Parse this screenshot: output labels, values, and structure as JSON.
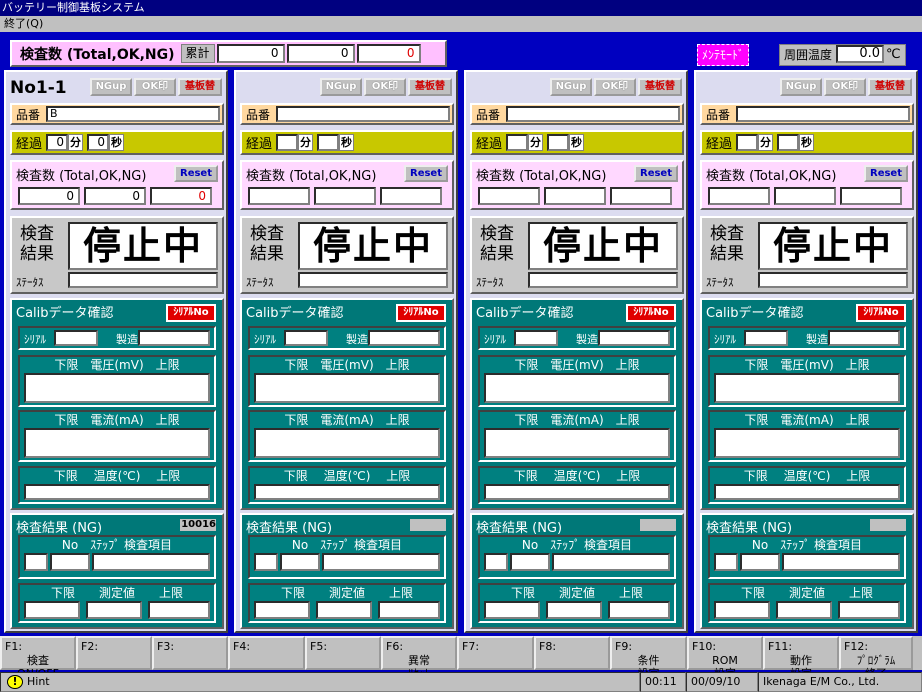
{
  "window": {
    "title": "バッテリー制御基板システム",
    "menu_end": "終了(Q)"
  },
  "top": {
    "count_label": "検査数 (Total,OK,NG)",
    "sum_label": "累計",
    "totals": [
      "0",
      "0",
      "0"
    ],
    "maint_mode": "ﾒﾝﾃﾓｰﾄﾞ",
    "ambient_label": "周囲温度",
    "ambient_value": "0.0",
    "ambient_unit": "℃"
  },
  "panel_buttons": {
    "ngup": "NGup",
    "ok": "OK印",
    "board": "基板替",
    "reset": "Reset",
    "serial_btn": "ｼﾘｱﾙNo"
  },
  "labels": {
    "product": "品番",
    "elapsed": "経過",
    "min": "分",
    "sec": "秒",
    "count": "検査数 (Total,OK,NG)",
    "result_label": "検査\n結果",
    "status": "ｽﾃｰﾀｽ",
    "calib": "Calibデータ確認",
    "serial": "ｼﾘｱﾙ",
    "mfg": "製造",
    "voltage": "下限　電圧(mV)　上限",
    "current": "下限　電流(mA)　上限",
    "temp": "下限　 温度(℃)　 上限",
    "ng_result": "検査結果 (NG)",
    "ng_cols": "No　ｽﾃｯﾌﾟ 検査項目",
    "ng_cols2": "下限　　測定値　　上限"
  },
  "panels": [
    {
      "id": "No1-1",
      "product": "B",
      "min": "0",
      "sec": "0",
      "counts": [
        "0",
        "0",
        "0"
      ],
      "result": "停止中",
      "ng_no": "10016"
    },
    {
      "id": "",
      "product": "",
      "min": "",
      "sec": "",
      "counts": [
        "",
        "",
        ""
      ],
      "result": "停止中",
      "ng_no": ""
    },
    {
      "id": "",
      "product": "",
      "min": "",
      "sec": "",
      "counts": [
        "",
        "",
        ""
      ],
      "result": "停止中",
      "ng_no": ""
    },
    {
      "id": "",
      "product": "",
      "min": "",
      "sec": "",
      "counts": [
        "",
        "",
        ""
      ],
      "result": "停止中",
      "ng_no": ""
    }
  ],
  "fkeys": [
    {
      "k": "F1:",
      "l": "検査\nON/OFF"
    },
    {
      "k": "F2:",
      "l": ""
    },
    {
      "k": "F3:",
      "l": ""
    },
    {
      "k": "F4:",
      "l": ""
    },
    {
      "k": "F5:",
      "l": ""
    },
    {
      "k": "F6:",
      "l": "異常\nﾘｾｯﾄ"
    },
    {
      "k": "F7:",
      "l": ""
    },
    {
      "k": "F8:",
      "l": ""
    },
    {
      "k": "F9:",
      "l": "条件\n設定"
    },
    {
      "k": "F10:",
      "l": "ROM\n設定"
    },
    {
      "k": "F11:",
      "l": "動作\n設定"
    },
    {
      "k": "F12:",
      "l": "ﾌﾟﾛｸﾞﾗﾑ\n終了"
    }
  ],
  "status": {
    "hint": "Hint",
    "time": "00:11",
    "date": "00/09/10",
    "company": "Ikenaga E/M Co., Ltd."
  }
}
